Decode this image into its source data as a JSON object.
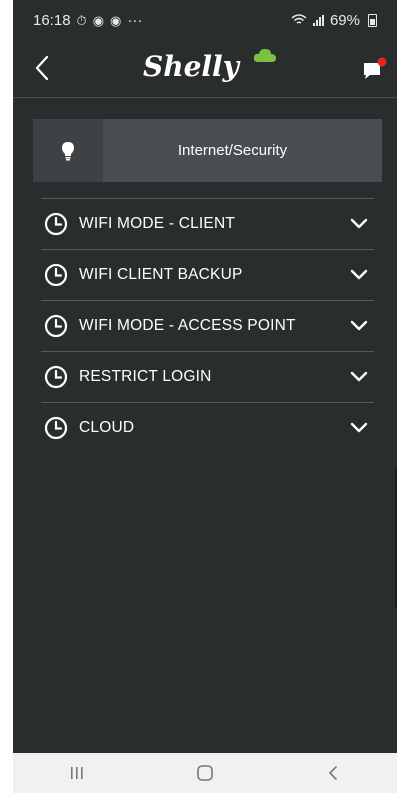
{
  "status_bar": {
    "time": "16:18",
    "extra": "···",
    "battery": "69%"
  },
  "header": {
    "logo_text": "Shelly",
    "colors": {
      "logo_cloud": "#7cc142",
      "notification_dot": "#e5261f"
    }
  },
  "section": {
    "icon": "lightbulb-icon",
    "title": "Internet/Security"
  },
  "settings": {
    "items": [
      {
        "label": "WIFI MODE - CLIENT",
        "icon": "clock-icon"
      },
      {
        "label": "WIFI CLIENT BACKUP",
        "icon": "clock-icon"
      },
      {
        "label": "WIFI MODE - ACCESS POINT",
        "icon": "clock-icon"
      },
      {
        "label": "RESTRICT LOGIN",
        "icon": "clock-icon"
      },
      {
        "label": "CLOUD",
        "icon": "clock-icon"
      }
    ]
  },
  "nav_bar": {
    "recents_icon": "recents-icon",
    "home_icon": "home-icon",
    "back_icon": "back-icon"
  }
}
